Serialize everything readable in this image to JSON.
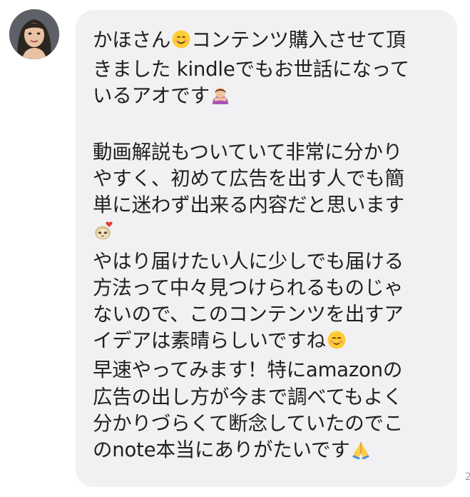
{
  "message": {
    "lines": [
      "かほさん",
      "コンテンツ購入させて頂",
      "きました kindleでもお世話になって",
      "いるアオです",
      "",
      "動画解説もついていて非常に分かり",
      "やすく、初めて広告を出す人でも簡",
      "単に迷わず出来る内容だと思います",
      "",
      "やはり届けたい人に少しでも届ける",
      "方法って中々見つけられるものじゃ",
      "ないので、このコンテンツを出すア",
      "イデアは素晴らしいですね",
      "早速やってみます！特にamazonの",
      "広告の出し方が今まで調べてもよく",
      "分かりづらくて断念していたのでこ",
      "のnote本当にありがたいです"
    ],
    "emojis": {
      "smile": "smiling-face-emoji",
      "bow": "person-bowing-emoji",
      "sloth": "sloth-heart-emoji",
      "blush": "smiling-face-blush-emoji",
      "pray": "folded-hands-emoji"
    }
  },
  "timestamp": "2",
  "colors": {
    "bubble": "#f1f1f3",
    "text": "#1f1f1f",
    "background": "#ffffff"
  }
}
